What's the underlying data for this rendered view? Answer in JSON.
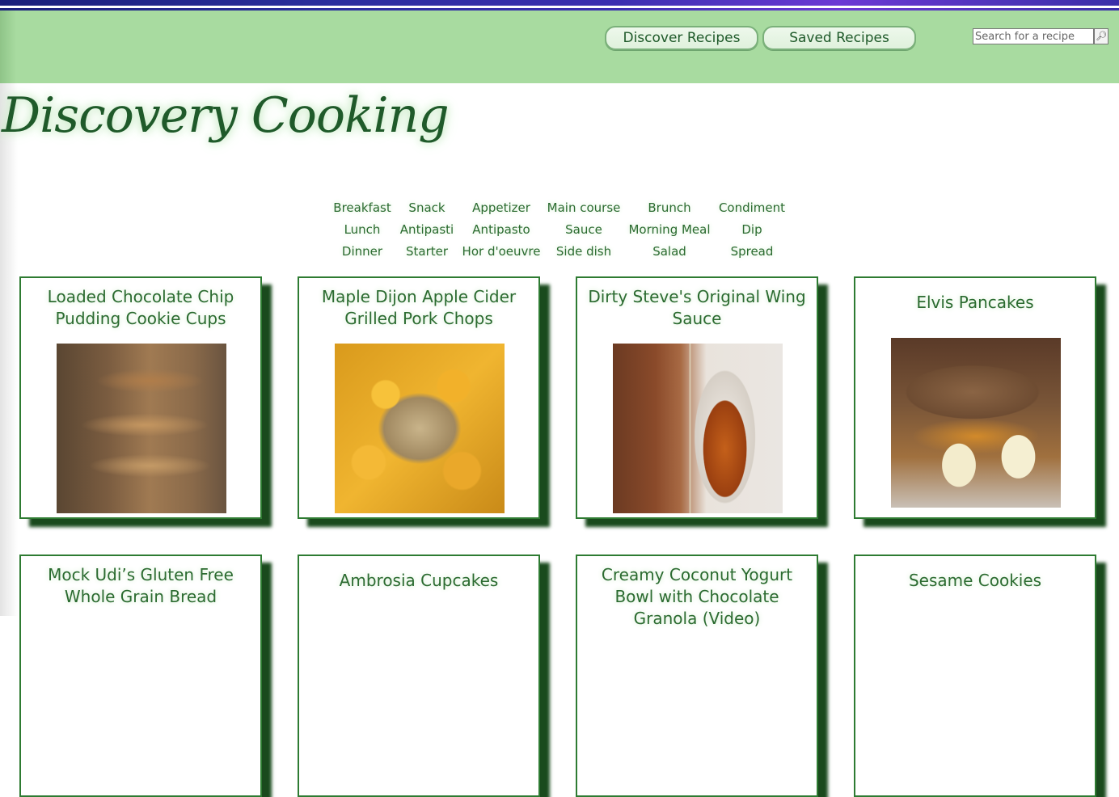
{
  "header": {
    "nav_buttons": [
      "Discover Recipes",
      "Saved Recipes"
    ],
    "search": {
      "placeholder": "Search for a recipe",
      "button_icon": "search-icon"
    },
    "colors": {
      "navbar": "#a8dba0",
      "primary_green": "#2b6b30",
      "card_shadow": "#1a4a1d"
    }
  },
  "site_title": "Discovery Cooking",
  "categories": [
    [
      "Breakfast",
      "Snack",
      "Appetizer",
      "Main course",
      "Brunch",
      "Condiment"
    ],
    [
      "Lunch",
      "Antipasti",
      "Antipasto",
      "Sauce",
      "Morning Meal",
      "Dip"
    ],
    [
      "Dinner",
      "Starter",
      "Hor d'oeuvre",
      "Side dish",
      "Salad",
      "Spread"
    ]
  ],
  "recipes": [
    {
      "title": "Loaded Chocolate Chip Pudding Cookie Cups"
    },
    {
      "title": "Maple Dijon Apple Cider Grilled Pork Chops"
    },
    {
      "title": "Dirty Steve's Original Wing Sauce"
    },
    {
      "title": "Elvis Pancakes"
    },
    {
      "title": "Mock Udi’s Gluten Free Whole Grain Bread"
    },
    {
      "title": "Ambrosia Cupcakes"
    },
    {
      "title": "Creamy Coconut Yogurt Bowl with Chocolate Granola (Video)"
    },
    {
      "title": "Sesame Cookies"
    }
  ]
}
